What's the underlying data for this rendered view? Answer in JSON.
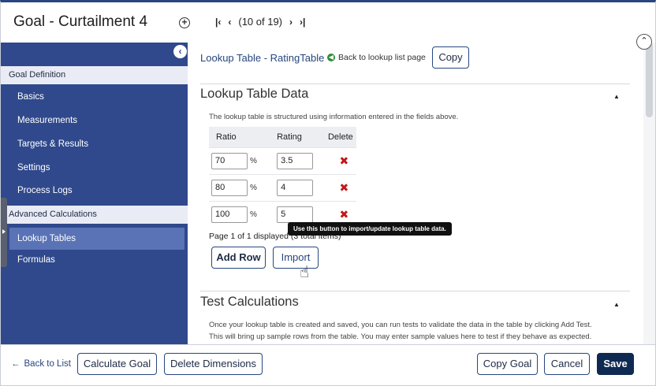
{
  "header": {
    "title": "Goal - Curtailment 4",
    "pager": {
      "first": "⏮",
      "prev": "‹",
      "status": "(10 of 19)",
      "next": "›",
      "last": "⏭"
    }
  },
  "sidebar": {
    "collapse_icon": "‹",
    "section_1": "Goal Definition",
    "items_1": [
      "Basics",
      "Measurements",
      "Targets & Results",
      "Settings",
      "Process Logs"
    ],
    "section_2": "Advanced Calculations",
    "items_2": [
      "Lookup Tables",
      "Formulas"
    ],
    "active_item": "Lookup Tables"
  },
  "lookup": {
    "heading": "Lookup Table - RatingTable",
    "back_link": "Back to lookup list page",
    "copy_button": "Copy",
    "section_title": "Lookup Table Data",
    "note": "The lookup table is structured using information entered in the fields above.",
    "columns": [
      "Ratio",
      "Rating",
      "Delete"
    ],
    "rows": [
      {
        "ratio": "70",
        "unit": "%",
        "rating": "3.5"
      },
      {
        "ratio": "80",
        "unit": "%",
        "rating": "4"
      },
      {
        "ratio": "100",
        "unit": "%",
        "rating": "5"
      }
    ],
    "delete_icon": "✖",
    "page_info": "Page 1 of 1 displayed (3 total items)",
    "add_row_button": "Add Row",
    "import_button": "Import",
    "tooltip": "Use this button to import/update lookup table data."
  },
  "test": {
    "section_title": "Test Calculations",
    "note_line1": "Once your lookup table is created and saved, you can run tests to validate the data in the table by clicking Add Test.",
    "note_line2": "This will bring up sample rows from the table. You may enter sample values here to test if they behave as expected."
  },
  "footer": {
    "back_to_list": "Back to List",
    "calculate_goal": "Calculate Goal",
    "delete_dimensions": "Delete Dimensions",
    "copy_goal": "Copy Goal",
    "cancel": "Cancel",
    "save": "Save"
  },
  "colors": {
    "brand": "#30498c",
    "primary": "#0f2a52",
    "danger": "#c0191c",
    "success": "#2e8b3d"
  }
}
